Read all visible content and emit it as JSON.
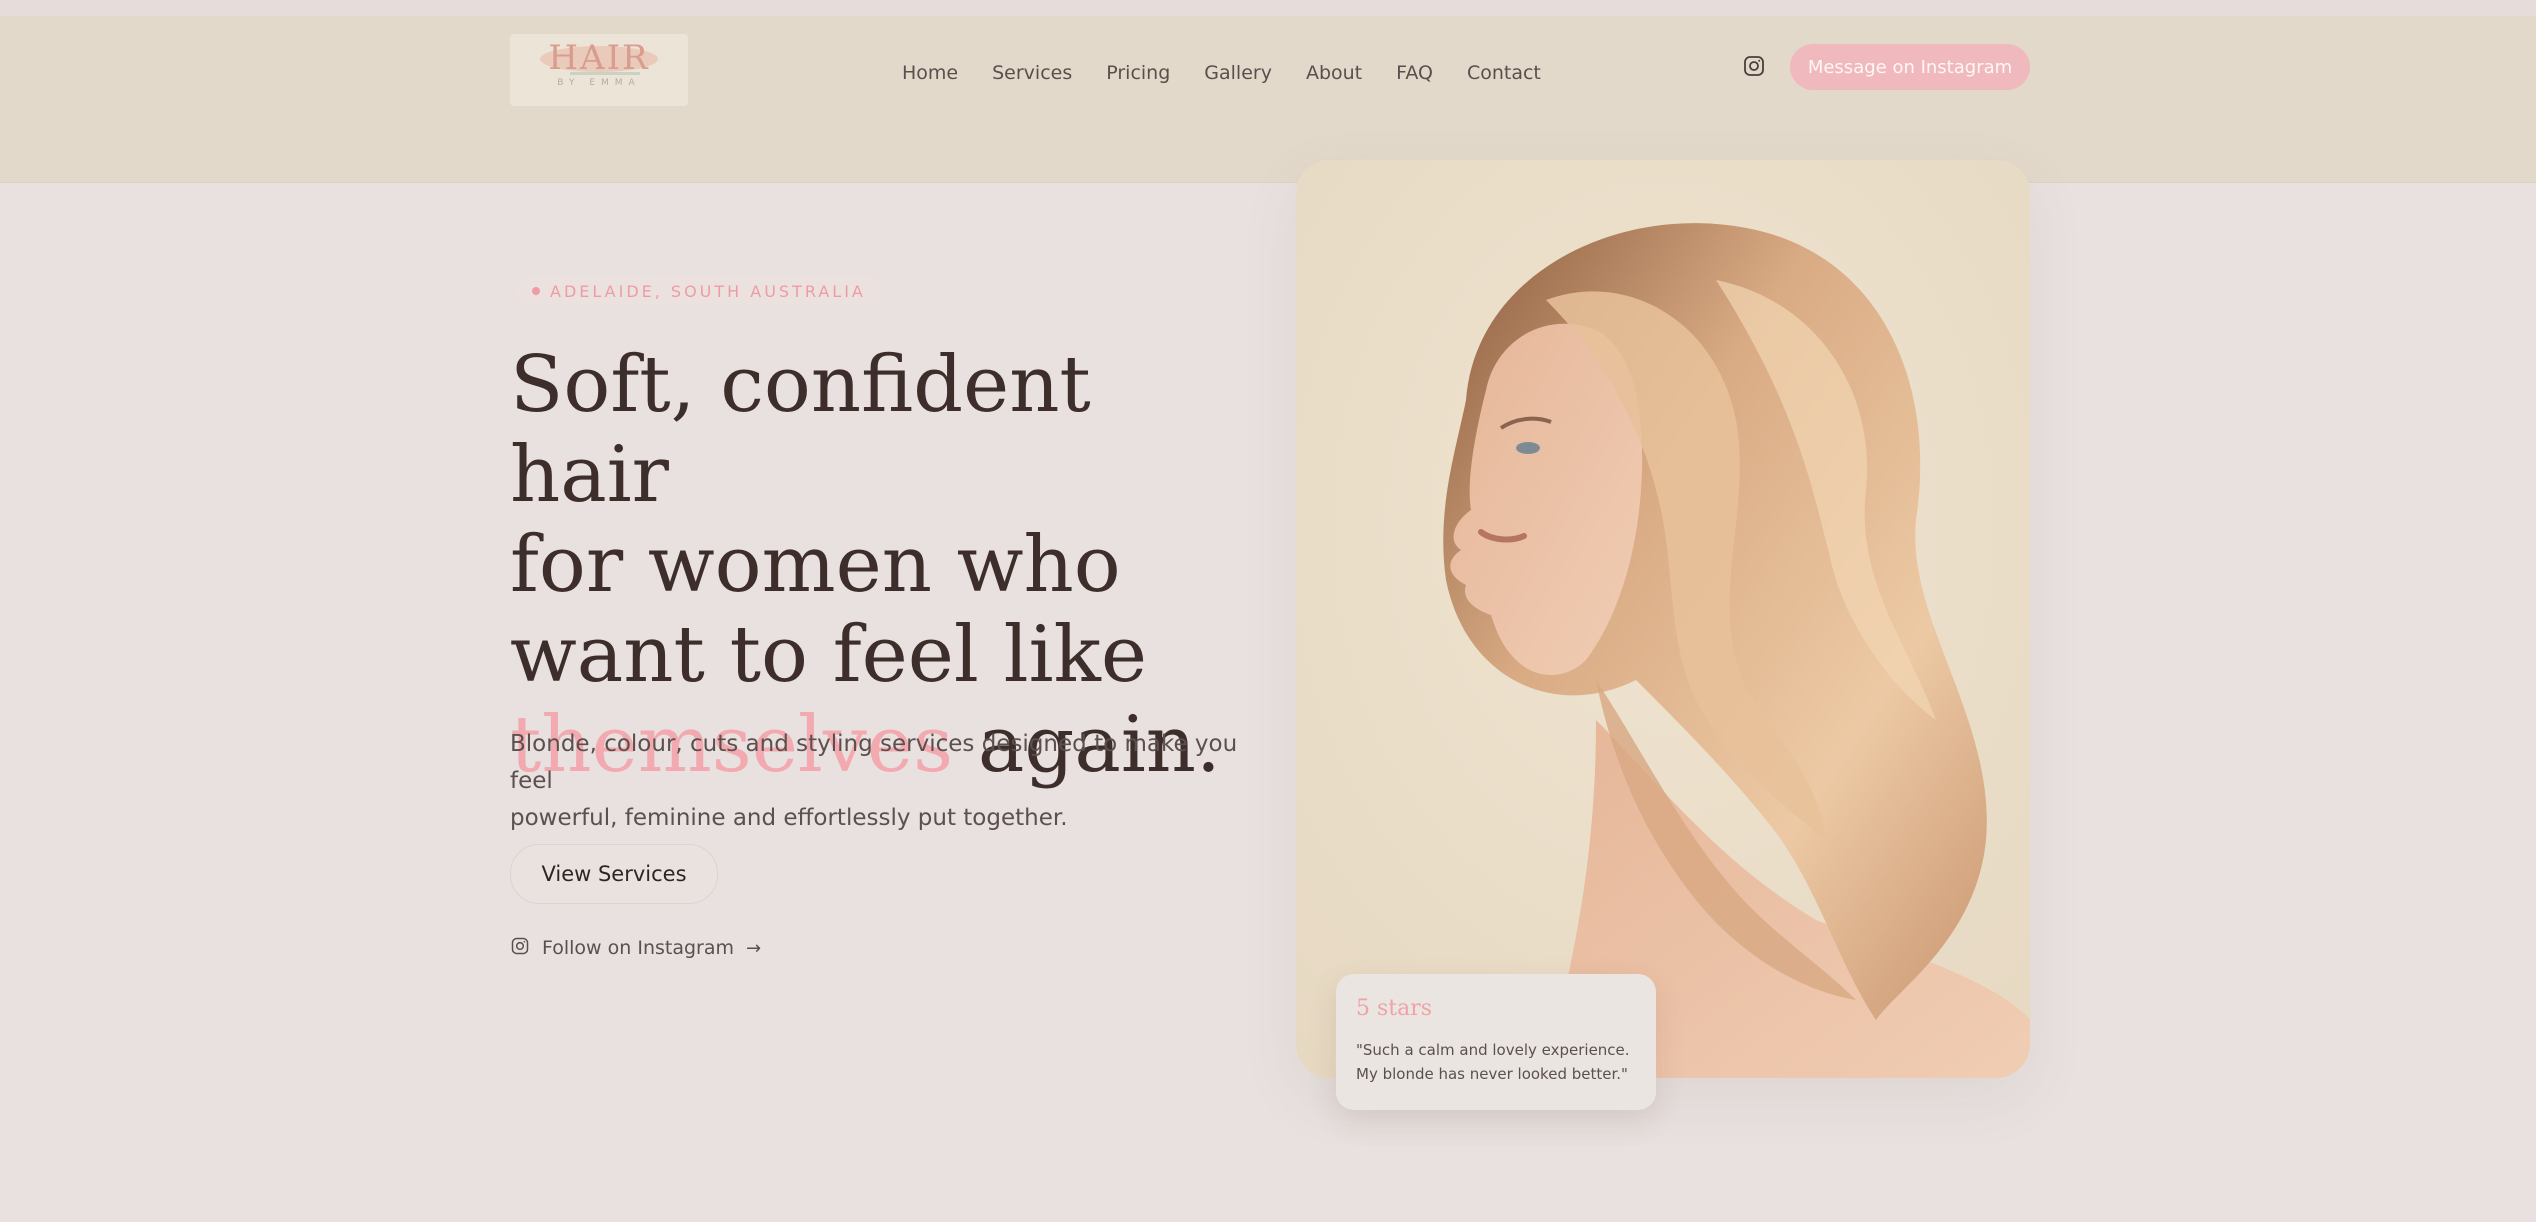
{
  "logo": {
    "text": "HAIR",
    "sub": "BY EMMA"
  },
  "nav": {
    "items": [
      "Home",
      "Services",
      "Pricing",
      "Gallery",
      "About",
      "FAQ",
      "Contact"
    ]
  },
  "header": {
    "cta_label": "Message on Instagram",
    "instagram_icon": "instagram-icon"
  },
  "hero": {
    "badge": "ADELAIDE, SOUTH AUSTRALIA",
    "headline_line1": "Soft, confident hair",
    "headline_line2": "for women who",
    "headline_line3": "want to feel like",
    "headline_accent": "themselves",
    "headline_end": "again.",
    "subheadline_line1": "Blonde, colour, cuts and styling services designed to make you feel",
    "subheadline_line2": "powerful, feminine and effortlessly put together.",
    "primary_button": "View Services",
    "follow_label": "Follow on Instagram",
    "follow_arrow": "→"
  },
  "review": {
    "stars_label": "5 stars",
    "quote_line1": "\"Such a calm and lovely experience.",
    "quote_line2": "My blonde has never looked better.\""
  },
  "colors": {
    "accent_pink": "#f0b9bd",
    "accent_text": "#f2aab0",
    "header_bg": "#e3d9cb",
    "page_bg": "#e8e1df",
    "card_bg": "#ebdfcb",
    "heading": "#3d2e2b"
  }
}
